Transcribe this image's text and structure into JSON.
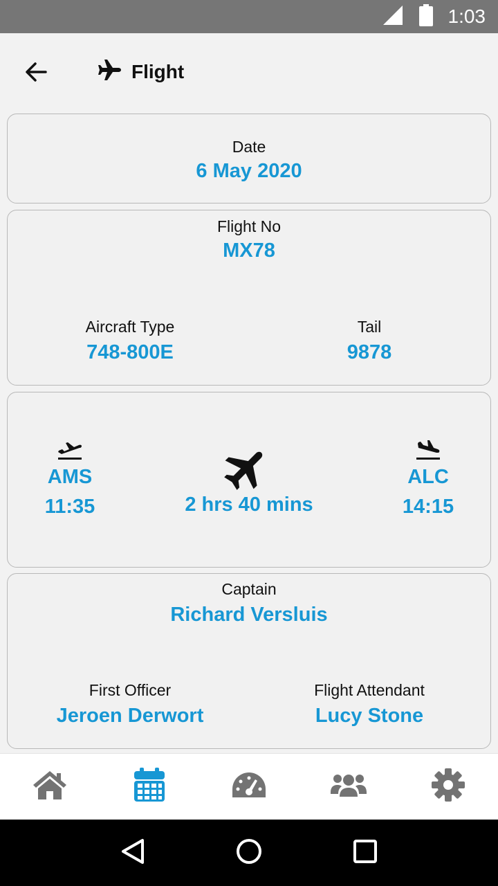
{
  "status_bar": {
    "time": "1:03"
  },
  "header": {
    "title": "Flight"
  },
  "date_card": {
    "label": "Date",
    "value": "6 May 2020"
  },
  "flight_card": {
    "flight_no_label": "Flight No",
    "flight_no": "MX78",
    "aircraft_type_label": "Aircraft Type",
    "aircraft_type": "748-800E",
    "tail_label": "Tail",
    "tail": "9878"
  },
  "route_card": {
    "departure_code": "AMS",
    "departure_time": "11:35",
    "duration": "2 hrs 40 mins",
    "arrival_code": "ALC",
    "arrival_time": "14:15"
  },
  "crew_card": {
    "captain_label": "Captain",
    "captain": "Richard Versluis",
    "first_officer_label": "First Officer",
    "first_officer": "Jeroen Derwort",
    "attendant_label": "Flight Attendant",
    "attendant": "Lucy Stone"
  },
  "bottom_nav": {
    "items": [
      "home-icon",
      "calendar-icon",
      "dashboard-icon",
      "crew-icon",
      "settings-icon"
    ],
    "active_color": "#1797d4",
    "inactive_color": "#737373"
  }
}
